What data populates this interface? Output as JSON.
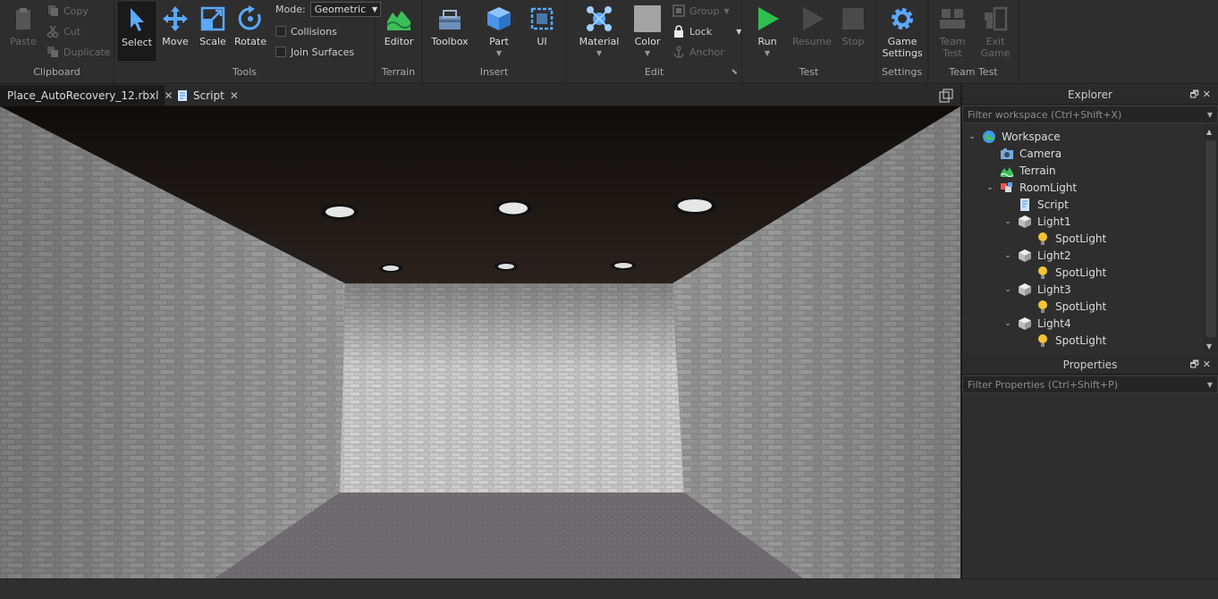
{
  "ribbon": {
    "clipboard": {
      "label": "Clipboard",
      "paste": "Paste",
      "copy": "Copy",
      "cut": "Cut",
      "duplicate": "Duplicate"
    },
    "tools": {
      "label": "Tools",
      "select": "Select",
      "move": "Move",
      "scale": "Scale",
      "rotate": "Rotate",
      "mode_label": "Mode:",
      "mode_value": "Geometric",
      "collisions": "Collisions",
      "join_surfaces": "Join Surfaces"
    },
    "terrain": {
      "label": "Terrain",
      "editor": "Editor"
    },
    "insert": {
      "label": "Insert",
      "toolbox": "Toolbox",
      "part": "Part",
      "ui": "UI"
    },
    "edit": {
      "label": "Edit",
      "material": "Material",
      "color": "Color",
      "group": "Group",
      "lock": "Lock",
      "anchor": "Anchor"
    },
    "test": {
      "label": "Test",
      "run": "Run",
      "resume": "Resume",
      "stop": "Stop"
    },
    "settings": {
      "label": "Settings",
      "game_settings_1": "Game",
      "game_settings_2": "Settings"
    },
    "team_test": {
      "label": "Team Test",
      "team_test_1": "Team",
      "team_test_2": "Test",
      "exit_game_1": "Exit",
      "exit_game_2": "Game"
    }
  },
  "tabs": [
    {
      "label": "Place_AutoRecovery_12.rbxl",
      "close": "✕"
    },
    {
      "label": "Script",
      "close": "✕"
    }
  ],
  "explorer": {
    "title": "Explorer",
    "filter_placeholder": "Filter workspace (Ctrl+Shift+X)",
    "items": [
      {
        "label": "Workspace",
        "icon": "workspace-icon"
      },
      {
        "label": "Camera",
        "icon": "camera-icon"
      },
      {
        "label": "Terrain",
        "icon": "terrain-icon"
      },
      {
        "label": "RoomLight",
        "icon": "model-icon"
      },
      {
        "label": "Script",
        "icon": "script-icon"
      },
      {
        "label": "Light1",
        "icon": "part-icon"
      },
      {
        "label": "SpotLight",
        "icon": "spotlight-icon"
      },
      {
        "label": "Light2",
        "icon": "part-icon"
      },
      {
        "label": "SpotLight",
        "icon": "spotlight-icon"
      },
      {
        "label": "Light3",
        "icon": "part-icon"
      },
      {
        "label": "SpotLight",
        "icon": "spotlight-icon"
      },
      {
        "label": "Light4",
        "icon": "part-icon"
      },
      {
        "label": "SpotLight",
        "icon": "spotlight-icon"
      }
    ]
  },
  "properties": {
    "title": "Properties",
    "filter_placeholder": "Filter Properties (Ctrl+Shift+P)"
  },
  "colors": {
    "accent_blue": "#5aa9ff",
    "run_green": "#2fbf4f",
    "terrain_green": "#3bbf5a"
  }
}
